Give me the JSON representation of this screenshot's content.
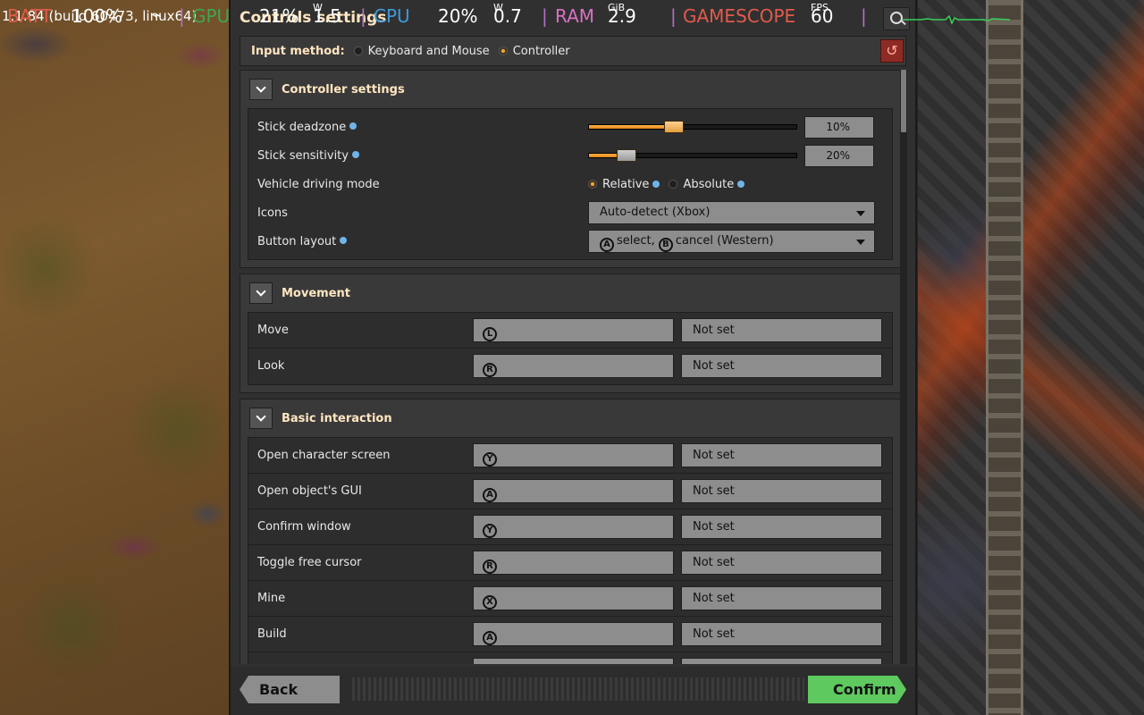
{
  "overlay": {
    "version": "1.1.84 (build 60473, linux64)",
    "bat_label": "BATT",
    "bat_value": "100%",
    "gpu_label": "GPU",
    "gpu_value": "21%",
    "gpu_watts": "1.5",
    "gpu_watts_unit": "W",
    "cpu_label": "CPU",
    "cpu_value": "20%",
    "cpu_watts": "0.7",
    "cpu_watts_unit": "W",
    "ram_label": "RAM",
    "ram_value": "2.9",
    "ram_unit": "GiB",
    "gamescope_label": "GAMESCOPE",
    "fps_value": "60",
    "fps_unit": "FPS"
  },
  "window": {
    "title": "Controls settings"
  },
  "input_method": {
    "label": "Input method:",
    "options": [
      "Keyboard and Mouse",
      "Controller"
    ],
    "selected": "Controller"
  },
  "controller_settings": {
    "title": "Controller settings",
    "stick_deadzone": {
      "label": "Stick deadzone",
      "value": "10%",
      "fraction": 0.41
    },
    "stick_sensitivity": {
      "label": "Stick sensitivity",
      "value": "20%",
      "fraction": 0.18
    },
    "vehicle_mode": {
      "label": "Vehicle driving mode",
      "options": [
        "Relative",
        "Absolute"
      ],
      "selected": "Relative"
    },
    "icons": {
      "label": "Icons",
      "value": "Auto-detect (Xbox)"
    },
    "button_layout": {
      "label": "Button layout",
      "value_a": "select,",
      "value_b": "cancel (Western)",
      "glyph_a": "A",
      "glyph_b": "B"
    }
  },
  "movement": {
    "title": "Movement",
    "rows": [
      {
        "label": "Move",
        "glyph": "L",
        "secondary": "Not set"
      },
      {
        "label": "Look",
        "glyph": "R",
        "secondary": "Not set"
      }
    ]
  },
  "basic_interaction": {
    "title": "Basic interaction",
    "rows": [
      {
        "label": "Open character screen",
        "glyph": "Y",
        "secondary": "Not set"
      },
      {
        "label": "Open object's GUI",
        "glyph": "A",
        "secondary": "Not set"
      },
      {
        "label": "Confirm window",
        "glyph": "Y",
        "secondary": "Not set"
      },
      {
        "label": "Toggle free cursor",
        "glyph": "R",
        "secondary": "Not set"
      },
      {
        "label": "Mine",
        "glyph": "X",
        "secondary": "Not set"
      },
      {
        "label": "Build",
        "glyph": "A",
        "secondary": "Not set"
      }
    ]
  },
  "footer": {
    "back_label": "Back",
    "confirm_label": "Confirm"
  },
  "colors": {
    "accent_orange": "#f0a43a",
    "confirm_green": "#5ec95e",
    "heading": "#ffe6c0"
  }
}
